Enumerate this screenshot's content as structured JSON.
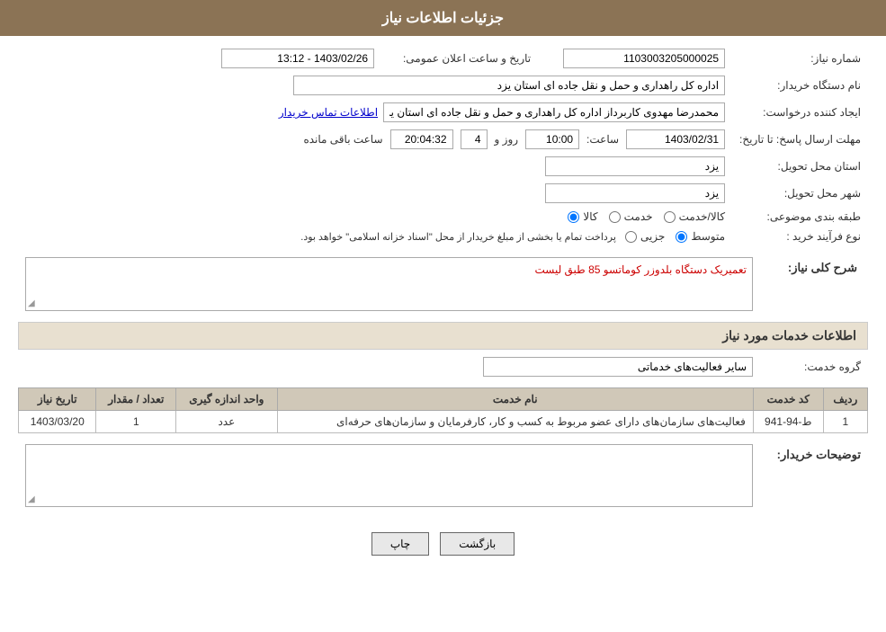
{
  "header": {
    "title": "جزئیات اطلاعات نیاز"
  },
  "fields": {
    "need_number_label": "شماره نیاز:",
    "need_number_value": "1103003205000025",
    "announce_datetime_label": "تاریخ و ساعت اعلان عمومی:",
    "announce_datetime_value": "1403/02/26 - 13:12",
    "buyer_org_label": "نام دستگاه خریدار:",
    "buyer_org_value": "اداره کل راهداری و حمل و نقل جاده ای استان یزد",
    "creator_label": "ایجاد کننده درخواست:",
    "creator_value": "محمدرضا مهدوی کاربرداز اداره کل راهداری و حمل و نقل جاده ای استان یزد",
    "contact_info_link": "اطلاعات تماس خریدار",
    "response_deadline_label": "مهلت ارسال پاسخ: تا تاریخ:",
    "response_date": "1403/02/31",
    "response_time_label": "ساعت:",
    "response_time": "10:00",
    "response_days_label": "روز و",
    "response_days": "4",
    "response_remaining_label": "ساعت باقی مانده",
    "response_remaining": "20:04:32",
    "delivery_province_label": "استان محل تحویل:",
    "delivery_province_value": "یزد",
    "delivery_city_label": "شهر محل تحویل:",
    "delivery_city_value": "یزد",
    "category_label": "طبقه بندی موضوعی:",
    "category_options": [
      {
        "label": "کالا",
        "value": "kala"
      },
      {
        "label": "خدمت",
        "value": "khedmat"
      },
      {
        "label": "کالا/خدمت",
        "value": "kala_khedmat"
      }
    ],
    "category_selected": "kala",
    "purchase_type_label": "نوع فرآیند خرید :",
    "purchase_type_note": "پرداخت تمام یا بخشی از مبلغ خریدار از محل \"اسناد خزانه اسلامی\" خواهد بود.",
    "purchase_type_options": [
      {
        "label": "جزیی",
        "value": "jozi"
      },
      {
        "label": "متوسط",
        "value": "motavasset"
      }
    ],
    "purchase_type_selected": "motavasset"
  },
  "need_description_section": {
    "title": "شرح کلی نیاز:",
    "content": "تعمیریک دستگاه بلدوزر کوماتسو 85 طبق لیست"
  },
  "services_section": {
    "title": "اطلاعات خدمات مورد نیاز",
    "service_group_label": "گروه خدمت:",
    "service_group_value": "سایر فعالیت‌های خدماتی",
    "table": {
      "columns": [
        {
          "label": "ردیف",
          "key": "row"
        },
        {
          "label": "کد خدمت",
          "key": "service_code"
        },
        {
          "label": "نام خدمت",
          "key": "service_name"
        },
        {
          "label": "واحد اندازه گیری",
          "key": "unit"
        },
        {
          "label": "تعداد / مقدار",
          "key": "quantity"
        },
        {
          "label": "تاریخ نیاز",
          "key": "need_date"
        }
      ],
      "rows": [
        {
          "row": "1",
          "service_code": "ط-94-941",
          "service_name": "فعالیت‌های سازمان‌های دارای عضو مربوط به کسب و کار، کارفرمایان و سازمان‌های حرفه‌ای",
          "unit": "عدد",
          "quantity": "1",
          "need_date": "1403/03/20"
        }
      ]
    }
  },
  "buyer_notes_section": {
    "label": "توضیحات خریدار:",
    "content": ""
  },
  "buttons": {
    "print_label": "چاپ",
    "back_label": "بازگشت"
  }
}
